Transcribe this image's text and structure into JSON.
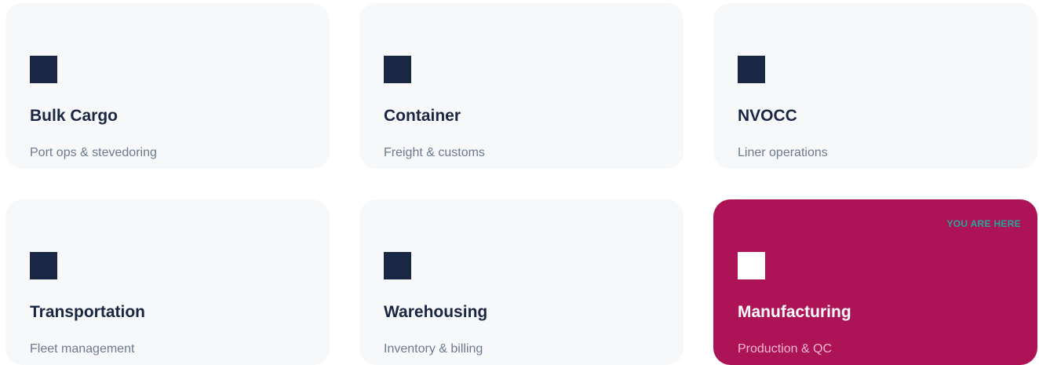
{
  "accent_color": "#ad1457",
  "badge_color": "#26a69a",
  "cards": [
    {
      "title": "Bulk Cargo",
      "subtitle": "Port ops & stevedoring",
      "icon": "square-icon"
    },
    {
      "title": "Container",
      "subtitle": "Freight & customs",
      "icon": "square-icon"
    },
    {
      "title": "NVOCC",
      "subtitle": "Liner operations",
      "icon": "square-icon"
    },
    {
      "title": "Transportation",
      "subtitle": "Fleet management",
      "icon": "square-icon"
    },
    {
      "title": "Warehousing",
      "subtitle": "Inventory & billing",
      "icon": "square-icon"
    },
    {
      "title": "Manufacturing",
      "subtitle": "Production & QC",
      "icon": "square-icon",
      "active": true,
      "badge": "YOU ARE HERE"
    }
  ]
}
